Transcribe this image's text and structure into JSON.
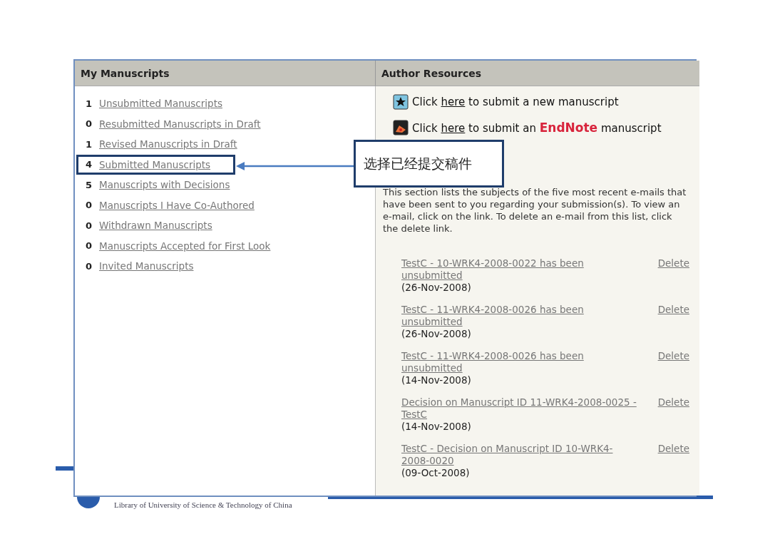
{
  "my_manuscripts": {
    "title": "My Manuscripts",
    "items": [
      {
        "count": "1",
        "label": "Unsubmitted Manuscripts",
        "selected": false
      },
      {
        "count": "0",
        "label": "Resubmitted Manuscripts in Draft",
        "selected": false
      },
      {
        "count": "1",
        "label": "Revised Manuscripts in Draft",
        "selected": false
      },
      {
        "count": "4",
        "label": "Submitted Manuscripts",
        "selected": true
      },
      {
        "count": "5",
        "label": "Manuscripts with Decisions",
        "selected": false
      },
      {
        "count": "0",
        "label": "Manuscripts I Have Co-Authored",
        "selected": false
      },
      {
        "count": "0",
        "label": "Withdrawn Manuscripts",
        "selected": false
      },
      {
        "count": "0",
        "label": "Manuscripts Accepted for First Look",
        "selected": false
      },
      {
        "count": "0",
        "label": "Invited Manuscripts",
        "selected": false
      }
    ]
  },
  "author_resources": {
    "title": "Author Resources",
    "actions": [
      {
        "kind": "new",
        "before": "Click ",
        "link": "here",
        "after": " to submit a new manuscript"
      },
      {
        "kind": "endnote",
        "before": "Click ",
        "link": "here",
        "after": " to submit an ",
        "logo": "EndNote",
        "tail": " manuscript"
      }
    ],
    "description": "This section lists the subjects of the five most recent e-mails that have been sent to you regarding your submission(s). To view an e-mail, click on the link. To delete an e-mail from this list, click the delete link.",
    "emails": [
      {
        "subject": "TestC - 10-WRK4-2008-0022 has been unsubmitted",
        "date": "(26-Nov-2008)",
        "action": "Delete"
      },
      {
        "subject": "TestC - 11-WRK4-2008-0026 has been unsubmitted",
        "date": "(26-Nov-2008)",
        "action": "Delete"
      },
      {
        "subject": "TestC - 11-WRK4-2008-0026 has been unsubmitted",
        "date": "(14-Nov-2008)",
        "action": "Delete"
      },
      {
        "subject": "Decision on Manuscript ID 11-WRK4-2008-0025 - TestC",
        "date": "(14-Nov-2008)",
        "action": "Delete"
      },
      {
        "subject": "TestC - Decision on Manuscript ID 10-WRK4-2008-0020",
        "date": "(09-Oct-2008)",
        "action": "Delete"
      }
    ]
  },
  "callout": {
    "text": "选择已经提交稿件"
  },
  "footer": {
    "text": "Library of University of Science & Technology of China"
  }
}
